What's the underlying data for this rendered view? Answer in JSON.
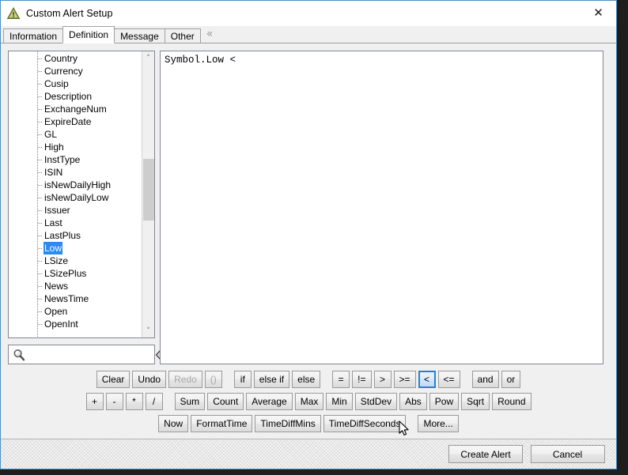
{
  "window": {
    "title": "Custom Alert Setup",
    "icon": "warning-triangle-icon",
    "close_label": "✕",
    "border_color": "#4a90c4"
  },
  "tabs": {
    "items": [
      {
        "label": "Information",
        "active": false
      },
      {
        "label": "Definition",
        "active": true
      },
      {
        "label": "Message",
        "active": false
      },
      {
        "label": "Other",
        "active": false
      }
    ],
    "scroll_glyph": "«"
  },
  "field_tree": {
    "items": [
      {
        "label": "Country",
        "selected": false
      },
      {
        "label": "Currency",
        "selected": false
      },
      {
        "label": "Cusip",
        "selected": false
      },
      {
        "label": "Description",
        "selected": false
      },
      {
        "label": "ExchangeNum",
        "selected": false
      },
      {
        "label": "ExpireDate",
        "selected": false
      },
      {
        "label": "GL",
        "selected": false
      },
      {
        "label": "High",
        "selected": false
      },
      {
        "label": "InstType",
        "selected": false
      },
      {
        "label": "ISIN",
        "selected": false
      },
      {
        "label": "isNewDailyHigh",
        "selected": false
      },
      {
        "label": "isNewDailyLow",
        "selected": false
      },
      {
        "label": "Issuer",
        "selected": false
      },
      {
        "label": "Last",
        "selected": false
      },
      {
        "label": "LastPlus",
        "selected": false
      },
      {
        "label": "Low",
        "selected": true
      },
      {
        "label": "LSize",
        "selected": false
      },
      {
        "label": "LSizePlus",
        "selected": false
      },
      {
        "label": "News",
        "selected": false
      },
      {
        "label": "NewsTime",
        "selected": false
      },
      {
        "label": "Open",
        "selected": false
      },
      {
        "label": "OpenInt",
        "selected": false
      }
    ],
    "selection_color": "#2a8aef",
    "scroll_up_glyph": "˄",
    "scroll_down_glyph": "˅"
  },
  "search": {
    "value": "",
    "placeholder": "",
    "icon": "magnifier-icon",
    "clear_icon": "backspace-clear-icon"
  },
  "editor": {
    "text": "Symbol.Low <"
  },
  "buttons": {
    "row1": [
      {
        "label": "Clear",
        "state": "normal"
      },
      {
        "label": "Undo",
        "state": "normal"
      },
      {
        "label": "Redo",
        "state": "disabled"
      },
      {
        "label": "()",
        "state": "disabled"
      },
      {
        "label": "",
        "state": "gap"
      },
      {
        "label": "if",
        "state": "normal"
      },
      {
        "label": "else if",
        "state": "normal"
      },
      {
        "label": "else",
        "state": "normal"
      },
      {
        "label": "",
        "state": "gap"
      },
      {
        "label": "=",
        "state": "normal"
      },
      {
        "label": "!=",
        "state": "normal"
      },
      {
        "label": ">",
        "state": "normal"
      },
      {
        "label": ">=",
        "state": "normal"
      },
      {
        "label": "<",
        "state": "hover"
      },
      {
        "label": "<=",
        "state": "normal"
      },
      {
        "label": "",
        "state": "gap"
      },
      {
        "label": "and",
        "state": "normal"
      },
      {
        "label": "or",
        "state": "normal"
      }
    ],
    "row2": [
      {
        "label": "+",
        "state": "normal"
      },
      {
        "label": "-",
        "state": "normal"
      },
      {
        "label": "*",
        "state": "normal"
      },
      {
        "label": "/",
        "state": "normal"
      },
      {
        "label": "",
        "state": "gap"
      },
      {
        "label": "Sum",
        "state": "normal"
      },
      {
        "label": "Count",
        "state": "normal"
      },
      {
        "label": "Average",
        "state": "normal"
      },
      {
        "label": "Max",
        "state": "normal"
      },
      {
        "label": "Min",
        "state": "normal"
      },
      {
        "label": "StdDev",
        "state": "normal"
      },
      {
        "label": "Abs",
        "state": "normal"
      },
      {
        "label": "Pow",
        "state": "normal"
      },
      {
        "label": "Sqrt",
        "state": "normal"
      },
      {
        "label": "Round",
        "state": "normal"
      }
    ],
    "row3": [
      {
        "label": "Now",
        "state": "normal"
      },
      {
        "label": "FormatTime",
        "state": "normal"
      },
      {
        "label": "TimeDiffMins",
        "state": "normal"
      },
      {
        "label": "TimeDiffSeconds",
        "state": "normal"
      },
      {
        "label": "",
        "state": "gap"
      },
      {
        "label": "More...",
        "state": "normal"
      }
    ]
  },
  "footer": {
    "create_label": "Create Alert",
    "cancel_label": "Cancel"
  }
}
